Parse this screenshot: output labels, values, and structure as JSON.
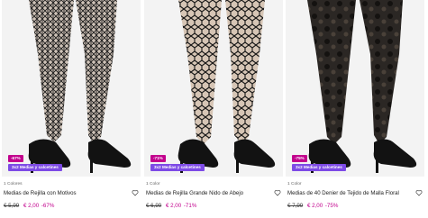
{
  "products": [
    {
      "colors_label": "1 Colores",
      "name": "Medias de Rejilla con Motivos",
      "discount_badge": "-67%",
      "promo_badge": "3x2 Medias y calcetines",
      "old_price": "€ 5,99",
      "new_price": "€ 2,00",
      "discount_text": "-67%",
      "image": "patterned-fishnet-tights-black-heels"
    },
    {
      "colors_label": "1 Color",
      "name": "Medias de Rejilla Grande Nido de Abejo",
      "discount_badge": "-71%",
      "promo_badge": "3x2 Medias y calcetines",
      "old_price": "€ 6,99",
      "new_price": "€ 2,00",
      "discount_text": "-71%",
      "image": "honeycomb-fishnet-tights-black-heels"
    },
    {
      "colors_label": "1 Color",
      "name": "Medias de 40 Denier de Tejido de Malla Floral",
      "discount_badge": "-75%",
      "promo_badge": "3x2 Medias y calcetines",
      "old_price": "€ 7,99",
      "new_price": "€ 2,00",
      "discount_text": "-75%",
      "image": "floral-40-denier-tights-black-heels"
    }
  ],
  "colors": {
    "accent": "#c2008d",
    "promo": "#7d4ae6",
    "photo_bg": "#f3f3f3"
  },
  "icons": [
    "heart-icon"
  ]
}
